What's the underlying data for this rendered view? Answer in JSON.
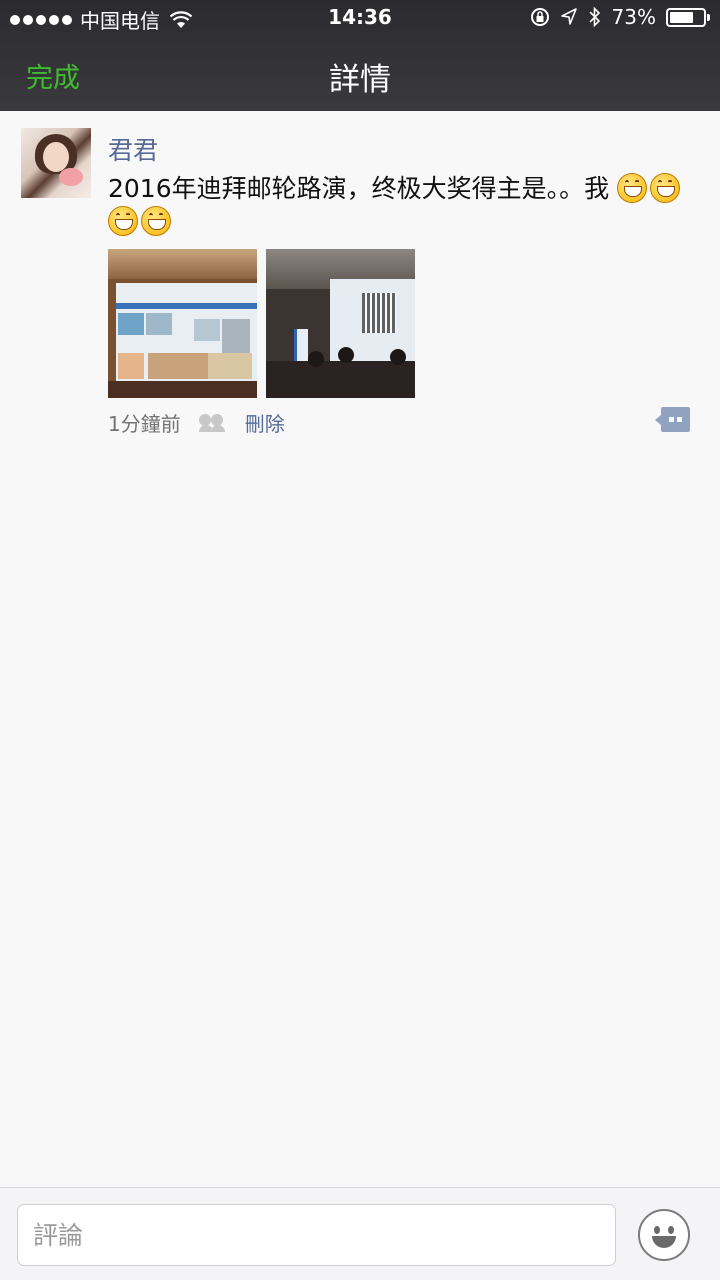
{
  "status_bar": {
    "carrier": "中国电信",
    "time": "14:36",
    "battery_text": "73%",
    "battery_level": 0.73,
    "icons": [
      "signal-dots-icon",
      "wifi-icon",
      "orientation-lock-icon",
      "location-icon",
      "bluetooth-icon",
      "battery-icon"
    ]
  },
  "nav": {
    "done_label": "完成",
    "title": "詳情"
  },
  "post": {
    "username": "君君",
    "text": "2016年迪拜邮轮路演，终极大奖得主是。。我 ",
    "emoji_count": 4,
    "images": [
      "dubai-roadshow-backdrop-photo",
      "conference-screen-photo"
    ],
    "time_ago": "1分鐘前",
    "delete_label": "刪除"
  },
  "comment_bar": {
    "placeholder": "評論"
  },
  "colors": {
    "accent_green": "#3ebd2f",
    "link_blue": "#576b95",
    "nav_bg": "#2b2b2f"
  }
}
